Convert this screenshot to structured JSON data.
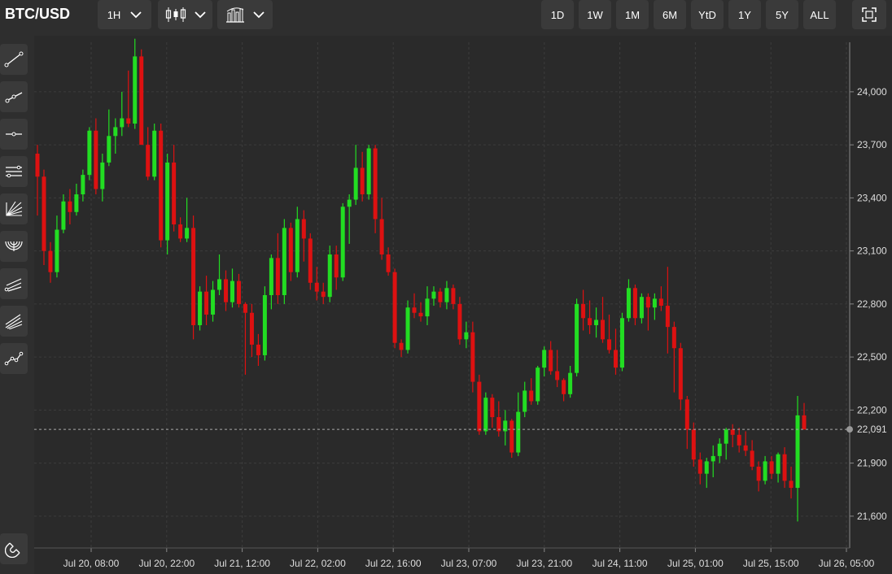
{
  "header": {
    "title": "BTC/USD",
    "interval_label": "1H",
    "chart_type_icon": "candlestick-icon",
    "indicators_icon": "bar-chart-icon",
    "ranges": [
      "1D",
      "1W",
      "1M",
      "6M",
      "YtD",
      "1Y",
      "5Y",
      "ALL"
    ],
    "fullscreen_icon": "fullscreen-icon"
  },
  "sidebar": {
    "tools": [
      "trend-line-icon",
      "ray-icon",
      "horizontal-line-icon",
      "parallel-channel-icon",
      "fan-icon",
      "arc-icon",
      "pitchfork-icon",
      "channel-lines-icon",
      "path-icon"
    ],
    "magnet_icon": "magnet-icon"
  },
  "colors": {
    "up": "#22dd22",
    "down": "#dd1111",
    "grid": "#3c3c3c",
    "background": "#2a2a2a"
  },
  "chart_data": {
    "type": "candlestick",
    "title": "BTC/USD",
    "interval": "1H",
    "y_ticks": [
      21600,
      21900,
      22200,
      22500,
      22800,
      23100,
      23400,
      23700,
      24000
    ],
    "ylim": [
      21420,
      24280
    ],
    "current_price": 22091,
    "current_price_label": "22,091",
    "x_ticks": [
      "Jul 20, 08:00",
      "Jul 20, 22:00",
      "Jul 21, 12:00",
      "Jul 22, 02:00",
      "Jul 22, 16:00",
      "Jul 23, 07:00",
      "Jul 23, 21:00",
      "Jul 24, 11:00",
      "Jul 25, 01:00",
      "Jul 25, 15:00",
      "Jul 26, 05:00"
    ],
    "grid": true,
    "candles": [
      [
        23650,
        23700,
        23300,
        23520
      ],
      [
        23520,
        23560,
        23020,
        23100
      ],
      [
        23100,
        23150,
        22920,
        22980
      ],
      [
        22980,
        23300,
        22950,
        23220
      ],
      [
        23220,
        23420,
        23200,
        23380
      ],
      [
        23380,
        23450,
        23250,
        23320
      ],
      [
        23320,
        23480,
        23300,
        23420
      ],
      [
        23420,
        23560,
        23380,
        23530
      ],
      [
        23530,
        23800,
        23500,
        23780
      ],
      [
        23780,
        23850,
        23420,
        23450
      ],
      [
        23450,
        23650,
        23380,
        23600
      ],
      [
        23600,
        23900,
        23580,
        23750
      ],
      [
        23750,
        23850,
        23650,
        23800
      ],
      [
        23800,
        24000,
        23750,
        23850
      ],
      [
        23850,
        24120,
        23800,
        23820
      ],
      [
        23820,
        24300,
        23790,
        24200
      ],
      [
        24200,
        24240,
        23900,
        23700
      ],
      [
        23700,
        23800,
        23500,
        23520
      ],
      [
        23520,
        23820,
        23500,
        23780
      ],
      [
        23780,
        23820,
        23120,
        23160
      ],
      [
        23160,
        23650,
        23080,
        23600
      ],
      [
        23600,
        23700,
        23210,
        23250
      ],
      [
        23250,
        23290,
        23150,
        23170
      ],
      [
        23170,
        23400,
        23150,
        23230
      ],
      [
        23230,
        23300,
        22600,
        22680
      ],
      [
        22680,
        22900,
        22650,
        22870
      ],
      [
        22870,
        22960,
        22680,
        22740
      ],
      [
        22740,
        22930,
        22700,
        22880
      ],
      [
        22880,
        23080,
        22850,
        22940
      ],
      [
        22940,
        22990,
        22760,
        22810
      ],
      [
        22810,
        23000,
        22780,
        22930
      ],
      [
        22930,
        22970,
        22780,
        22800
      ],
      [
        22800,
        22810,
        22400,
        22750
      ],
      [
        22750,
        22800,
        22500,
        22570
      ],
      [
        22570,
        22630,
        22450,
        22510
      ],
      [
        22510,
        22900,
        22480,
        22850
      ],
      [
        22850,
        23080,
        22770,
        23060
      ],
      [
        23060,
        23200,
        22800,
        22850
      ],
      [
        22850,
        23280,
        22800,
        23230
      ],
      [
        23230,
        23260,
        22930,
        22980
      ],
      [
        22980,
        23350,
        22950,
        23280
      ],
      [
        23280,
        23330,
        23040,
        23170
      ],
      [
        23170,
        23200,
        22880,
        22920
      ],
      [
        22920,
        23010,
        22820,
        22870
      ],
      [
        22870,
        22920,
        22800,
        22840
      ],
      [
        22840,
        23130,
        22810,
        23080
      ],
      [
        23080,
        23130,
        22880,
        22950
      ],
      [
        22950,
        23370,
        22930,
        23350
      ],
      [
        23350,
        23420,
        23140,
        23390
      ],
      [
        23390,
        23700,
        23360,
        23570
      ],
      [
        23570,
        23660,
        23380,
        23420
      ],
      [
        23420,
        23700,
        23390,
        23680
      ],
      [
        23680,
        23700,
        23200,
        23280
      ],
      [
        23280,
        23400,
        23050,
        23080
      ],
      [
        23080,
        23120,
        22960,
        22980
      ],
      [
        22980,
        23000,
        22550,
        22580
      ],
      [
        22580,
        22600,
        22500,
        22540
      ],
      [
        22540,
        22820,
        22520,
        22780
      ],
      [
        22780,
        22860,
        22720,
        22750
      ],
      [
        22750,
        22810,
        22700,
        22730
      ],
      [
        22730,
        22900,
        22680,
        22830
      ],
      [
        22830,
        22900,
        22790,
        22870
      ],
      [
        22870,
        22890,
        22780,
        22810
      ],
      [
        22810,
        22930,
        22770,
        22890
      ],
      [
        22890,
        22910,
        22770,
        22800
      ],
      [
        22800,
        22840,
        22570,
        22600
      ],
      [
        22600,
        22700,
        22550,
        22640
      ],
      [
        22640,
        22700,
        22300,
        22360
      ],
      [
        22360,
        22400,
        22060,
        22080
      ],
      [
        22080,
        22300,
        22060,
        22270
      ],
      [
        22270,
        22290,
        22100,
        22160
      ],
      [
        22160,
        22250,
        22050,
        22080
      ],
      [
        22080,
        22200,
        22000,
        22140
      ],
      [
        22140,
        22150,
        21930,
        21960
      ],
      [
        21960,
        22300,
        21940,
        22190
      ],
      [
        22190,
        22360,
        22160,
        22310
      ],
      [
        22310,
        22380,
        22230,
        22250
      ],
      [
        22250,
        22450,
        22230,
        22440
      ],
      [
        22440,
        22560,
        22390,
        22540
      ],
      [
        22540,
        22590,
        22400,
        22420
      ],
      [
        22420,
        22540,
        22330,
        22370
      ],
      [
        22370,
        22380,
        22250,
        22290
      ],
      [
        22290,
        22450,
        22270,
        22410
      ],
      [
        22410,
        22830,
        22390,
        22800
      ],
      [
        22800,
        22880,
        22650,
        22720
      ],
      [
        22720,
        22820,
        22630,
        22680
      ],
      [
        22680,
        22780,
        22610,
        22710
      ],
      [
        22710,
        22840,
        22580,
        22600
      ],
      [
        22600,
        22740,
        22520,
        22540
      ],
      [
        22540,
        22660,
        22400,
        22440
      ],
      [
        22440,
        22750,
        22420,
        22720
      ],
      [
        22720,
        22940,
        22700,
        22890
      ],
      [
        22890,
        22910,
        22680,
        22720
      ],
      [
        22720,
        22860,
        22690,
        22840
      ],
      [
        22840,
        22860,
        22650,
        22780
      ],
      [
        22780,
        22860,
        22710,
        22830
      ],
      [
        22830,
        22900,
        22760,
        22790
      ],
      [
        22790,
        23010,
        22520,
        22670
      ],
      [
        22670,
        22700,
        22300,
        22550
      ],
      [
        22550,
        22580,
        22200,
        22260
      ],
      [
        22260,
        22280,
        21980,
        22090
      ],
      [
        22090,
        22130,
        21880,
        21920
      ],
      [
        21920,
        21960,
        21780,
        21840
      ],
      [
        21840,
        21930,
        21760,
        21910
      ],
      [
        21910,
        22000,
        21820,
        21940
      ],
      [
        21940,
        22040,
        21900,
        22010
      ],
      [
        22010,
        22100,
        21920,
        22090
      ],
      [
        22090,
        22120,
        21990,
        22060
      ],
      [
        22060,
        22100,
        21960,
        22000
      ],
      [
        22000,
        22080,
        21940,
        21970
      ],
      [
        21970,
        22030,
        21860,
        21880
      ],
      [
        21880,
        21910,
        21740,
        21800
      ],
      [
        21800,
        21940,
        21780,
        21910
      ],
      [
        21910,
        21940,
        21810,
        21840
      ],
      [
        21840,
        21960,
        21790,
        21950
      ],
      [
        21950,
        21990,
        21760,
        21800
      ],
      [
        21800,
        21880,
        21700,
        21760
      ],
      [
        21760,
        22280,
        21570,
        22170
      ],
      [
        22170,
        22240,
        22090,
        22090
      ]
    ]
  }
}
